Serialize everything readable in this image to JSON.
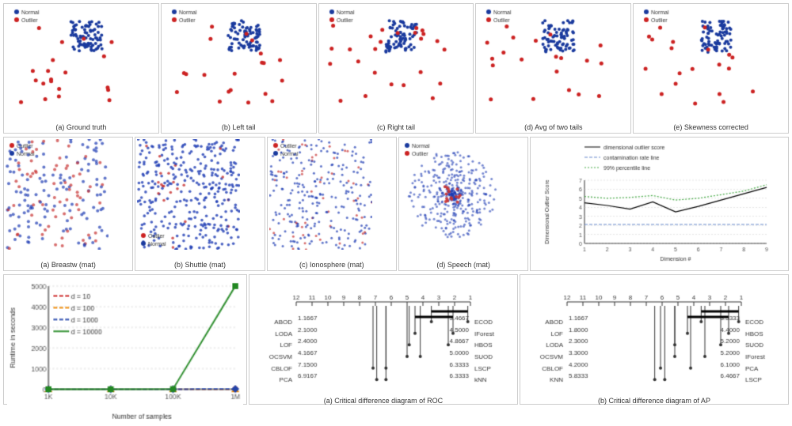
{
  "top_row": {
    "panels": [
      {
        "id": "a",
        "caption": "(a) Ground truth",
        "legend": true
      },
      {
        "id": "b",
        "caption": "(b) Left tail",
        "legend": true
      },
      {
        "id": "c",
        "caption": "(c) Right tail",
        "legend": true
      },
      {
        "id": "d",
        "caption": "(d) Avg of two tails",
        "legend": true
      },
      {
        "id": "e",
        "caption": "(e) Skewness corrected",
        "legend": true
      }
    ],
    "legend_normal": "Normal",
    "legend_outlier": "Outlier"
  },
  "middle_row": {
    "mat_panels": [
      {
        "id": "a",
        "caption": "(a) Breastw (mat)"
      },
      {
        "id": "b",
        "caption": "(b) Shuttle (mat)"
      },
      {
        "id": "c",
        "caption": "(c) Ionosphere (mat)"
      },
      {
        "id": "d",
        "caption": "(d) Speech (mat)"
      }
    ],
    "chart": {
      "title": "",
      "y_label": "Dimensional Outlier Score",
      "x_label": "Dimension #",
      "legend": [
        "dimensional outlier score",
        "contamination rate line",
        "99% percentile line"
      ]
    }
  },
  "bottom_row": {
    "runtime_legend": [
      "d = 10",
      "d = 100",
      "d = 1000",
      "d = 10000"
    ],
    "runtime_x_label": "Number of samples",
    "runtime_y_label": "Runtime in seconds",
    "cd_a_caption": "(a) Critical difference diagram of ROC",
    "cd_b_caption": "(b) Critical difference diagram of AP",
    "cd_a_items_left": [
      "ABOD",
      "LODA",
      "LOF",
      "OCSVM",
      "CBLOF",
      "PCA"
    ],
    "cd_a_values_left": [
      "1.1667",
      "2.1000",
      "2.4000",
      "4.1667",
      "7.1500",
      "6.9167"
    ],
    "cd_a_items_right": [
      "ECOD",
      "IForest",
      "HBOS",
      "SUOD",
      "LSCP",
      "kNN"
    ],
    "cd_a_values_right": [
      "3.4667",
      "4.5000",
      "4.8667",
      "5.0000",
      "6.3333",
      "6.3333"
    ],
    "cd_b_items_left": [
      "ABOD",
      "LOF",
      "LODA",
      "OCSVM",
      "CBLOF",
      "KNN"
    ],
    "cd_b_values_left": [
      "1.1667",
      "1.8000",
      "2.3000",
      "3.3000",
      "4.2000",
      "5.8333"
    ],
    "cd_b_items_right": [
      "ECOD",
      "HBOS",
      "SUOD",
      "IForest",
      "PCA",
      "LSCP"
    ],
    "cd_b_values_right": [
      "3.5333",
      "4.4000",
      "5.2000",
      "5.2000",
      "6.1000",
      "6.4667"
    ]
  }
}
